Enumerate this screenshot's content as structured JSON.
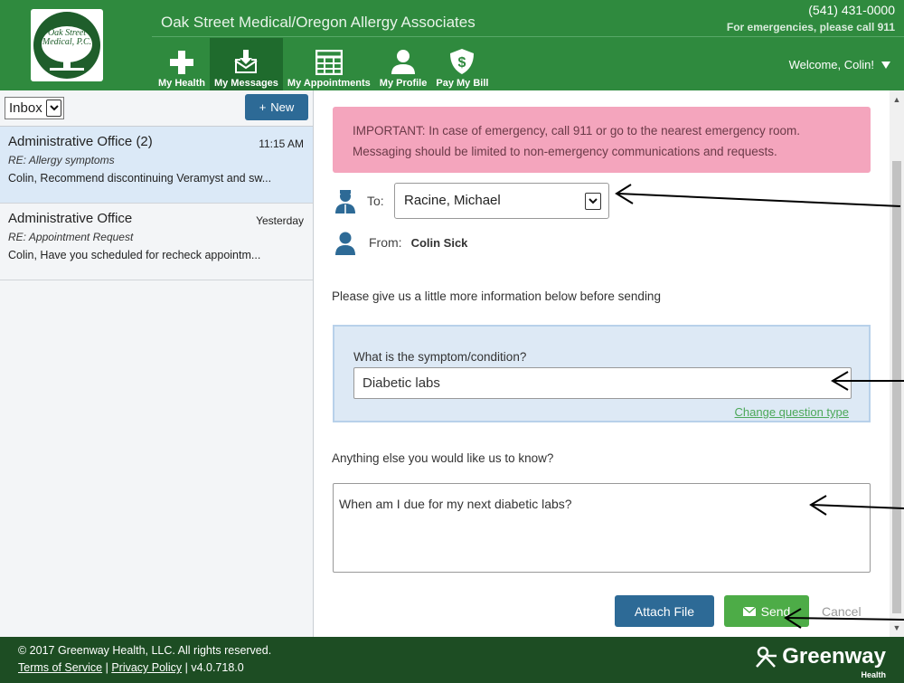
{
  "header": {
    "logo_text": "Oak Street Medical, P.C.",
    "practice_name": "Oak Street Medical/Oregon Allergy Associates",
    "phone": "(541) 431-0000",
    "emergency": "For emergencies, please call 911",
    "welcome": "Welcome, Colin!",
    "nav": [
      {
        "label": "My Health",
        "icon": "plus-icon"
      },
      {
        "label": "My Messages",
        "icon": "envelope-download-icon",
        "active": true
      },
      {
        "label": "My Appointments",
        "icon": "calendar-grid-icon"
      },
      {
        "label": "My Profile",
        "icon": "person-icon"
      },
      {
        "label": "Pay My Bill",
        "icon": "dollar-shield-icon"
      }
    ]
  },
  "sidebar": {
    "folder": "Inbox",
    "new_label": "New",
    "messages": [
      {
        "from": "Administrative Office (2)",
        "time": "11:15 AM",
        "subject": "RE: Allergy symptoms",
        "preview": "Colin, Recommend discontinuing Veramyst and sw..."
      },
      {
        "from": "Administrative Office",
        "time": "Yesterday",
        "subject": "RE: Appointment Request",
        "preview": "Colin, Have you scheduled for recheck appointm..."
      }
    ]
  },
  "compose": {
    "alert_line1": "IMPORTANT: In case of emergency, call 911 or go to the nearest emergency room.",
    "alert_line2": "Messaging should be limited to non-emergency communications and requests.",
    "to_label": "To:",
    "to_value": "Racine, Michael",
    "from_label": "From:",
    "from_value": "Colin Sick",
    "info": "Please give us a little more information below before sending",
    "question_label": "What is the symptom/condition?",
    "question_value": "Diabetic labs",
    "change_link": "Change question type",
    "else_label": "Anything else you would like us to know?",
    "else_value": "When am I due for my next diabetic labs?",
    "attach_label": "Attach File",
    "send_label": "Send",
    "cancel_label": "Cancel"
  },
  "footer": {
    "copyright": "© 2017 Greenway Health, LLC. All rights reserved.",
    "terms": "Terms of Service",
    "privacy": "Privacy Policy",
    "version": "v4.0.718.0",
    "brand": "Greenway",
    "brand_sub": "Health"
  },
  "colors": {
    "header_green": "#2f8a3e",
    "footer_green": "#1d4d23",
    "button_blue": "#2d6a96",
    "send_green": "#4dac47",
    "alert_pink": "#f4a5bd"
  }
}
